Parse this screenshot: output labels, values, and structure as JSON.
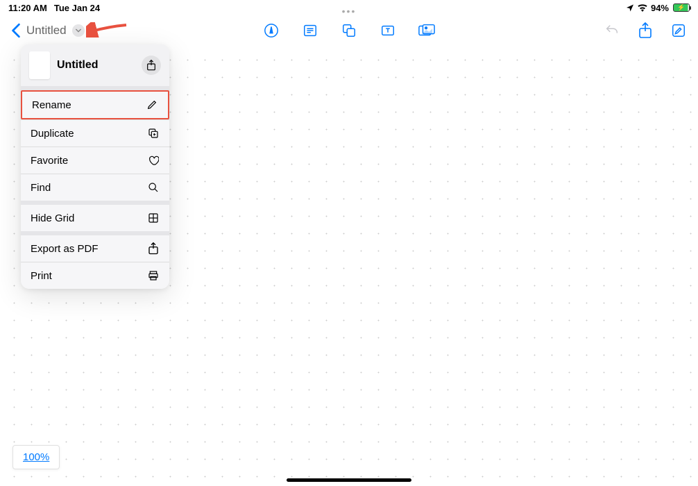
{
  "status_bar": {
    "time": "11:20 AM",
    "date": "Tue Jan 24",
    "battery_percent": "94%"
  },
  "toolbar": {
    "document_title": "Untitled"
  },
  "dropdown": {
    "header_title": "Untitled",
    "items": {
      "rename": "Rename",
      "duplicate": "Duplicate",
      "favorite": "Favorite",
      "find": "Find",
      "hide_grid": "Hide Grid",
      "export_pdf": "Export as PDF",
      "print": "Print"
    }
  },
  "zoom": {
    "level": "100%"
  }
}
